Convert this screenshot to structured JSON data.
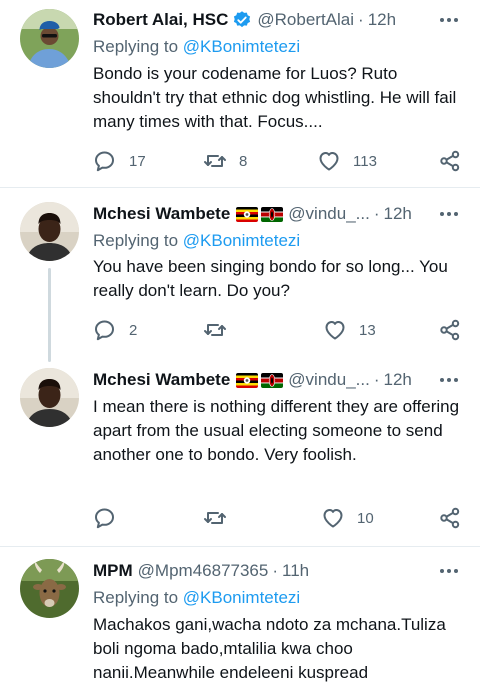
{
  "tweets": [
    {
      "name": "Robert Alai, HSC",
      "handle": "@RobertAlai",
      "time": "12h",
      "replying_prefix": "Replying to ",
      "replying_to": "@KBonimtetezi",
      "text": "Bondo is your codename for Luos? Ruto shouldn't try that ethnic dog whistling. He will fail many times with that. Focus....",
      "replies": "17",
      "retweets": "8",
      "likes": "113"
    },
    {
      "name": "Mchesi Wambete",
      "handle": "@vindu_...",
      "time": "12h",
      "replying_prefix": "Replying to ",
      "replying_to": "@KBonimtetezi",
      "text": "You have been singing bondo for so long... You really don't learn. Do you?",
      "replies": "2",
      "retweets": "",
      "likes": "13"
    },
    {
      "name": "Mchesi Wambete",
      "handle": "@vindu_...",
      "time": "12h",
      "text": "I mean there is nothing different they are offering apart from the usual electing someone to send another one to bondo. Very foolish.",
      "replies": "",
      "retweets": "",
      "likes": "10"
    },
    {
      "name": "MPM",
      "handle": "@Mpm46877365",
      "time": "11h",
      "replying_prefix": "Replying to ",
      "replying_to": "@KBonimtetezi",
      "text": "Machakos gani,wacha ndoto za mchana.Tuliza boli ngoma bado,mtalilia kwa choo nanii.Meanwhile endeleeni kuspread"
    }
  ],
  "separator": "·",
  "colors": {
    "accent": "#1d9bf0",
    "secondary_text": "#536471",
    "primary_text": "#0f1419",
    "divider": "#e6ecf0",
    "thread_line": "#cfd9de"
  },
  "icons": [
    "verified-badge-icon",
    "uganda-flag-icon",
    "kenya-flag-icon",
    "more-icon",
    "reply-icon",
    "retweet-icon",
    "like-icon",
    "share-icon"
  ]
}
